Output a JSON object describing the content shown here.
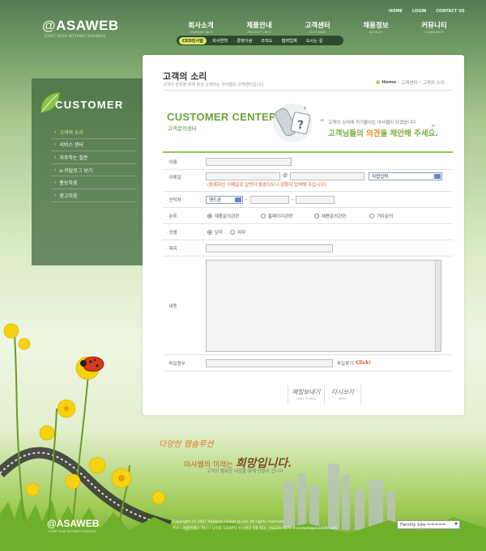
{
  "header": {
    "logo_text": "ASAWEB",
    "logo_prefix": "@",
    "logo_sub": "START YOUR INTERNET BUSINESS",
    "top_links": [
      "HOME",
      "LOGIN",
      "CONTACT US"
    ],
    "gnb": [
      {
        "label": "회사소개",
        "sub": "COMPANY INFO"
      },
      {
        "label": "제품안내",
        "sub": "PRODUCT INFO"
      },
      {
        "label": "고객센터",
        "sub": "CUSTOMER"
      },
      {
        "label": "채용정보",
        "sub": "RECRUIT"
      },
      {
        "label": "커뮤니티",
        "sub": "COMMUNITY"
      }
    ],
    "subnav": [
      "CEO인사말",
      "회사연혁",
      "경영이념",
      "조직도",
      "협력업체",
      "오시는 길"
    ]
  },
  "sidebar": {
    "title": "CUSTOMER",
    "items": [
      "고객의 소리",
      "서비스 센터",
      "자주하는 질문",
      "e-카탈로그 보기",
      "홍보자료",
      "광고모음"
    ],
    "active_index": 0
  },
  "page": {
    "title": "고객의 소리",
    "desc": "고객의 만족을 위해 항상 노력하는 아사웹의 고객센터입니다.",
    "breadcrumb": {
      "home": "Home",
      "mid": "고객센터",
      "current": "고객의 소리"
    }
  },
  "banner": {
    "title": "CUSTOMER CENTER",
    "subtitle": "고객문의센터",
    "line1": "고객의 소리에 귀기울이는 아사웹이 되겠습니다.",
    "line2_a": "고객님들의 ",
    "line2_em": "의견",
    "line2_b": "을 제안해 주세요."
  },
  "form": {
    "labels": {
      "name": "이름",
      "email": "이메일",
      "phone": "연락처",
      "category": "분류",
      "gender": "성별",
      "subject": "제목",
      "content": "내용",
      "attach": "파일첨부"
    },
    "email_at": "@",
    "email_domain_select": "직접입력",
    "email_note": "(등록하신 이메일로 답변이 발송되오니 정확히 입력해 주십시오)",
    "phone_select": "핸드폰",
    "phone_dash": "-",
    "category_options": [
      "제품문의관련",
      "홈페이지관련",
      "채용문의관련",
      "기타문의"
    ],
    "category_selected": 0,
    "gender_options": [
      "남자",
      "여자"
    ],
    "gender_selected": 0,
    "attach_label": "파일찾기",
    "attach_click": "Click!"
  },
  "buttons": {
    "send": {
      "label": "메일보내기",
      "sub": "SEND TO MAIL"
    },
    "reply": {
      "label": "다시쓰기",
      "sub": "REPLY"
    }
  },
  "footer": {
    "slogan1": "다양한 웹솔루션",
    "slogan2_a": "아사웹의 미래는 ",
    "slogan2_b": "희망입니다.",
    "slogan3": "고객의 행복한 내일을 함께 만들어 갑니다.",
    "logo_text": "ASAWEB",
    "logo_prefix": "@",
    "logo_sub": "START YOUR INTERNET BUSINESS",
    "copyright": "Copyright (c) 2007 ASAweb Global co.Ltd. All rights reserved.",
    "address": "주소 : 서울특별시 가나구 다라동 123번지 아사빌딩 4층  TEL : 01234-5678-9  asaweb@asaweb.com",
    "family_site": "Familly Site ====="
  }
}
